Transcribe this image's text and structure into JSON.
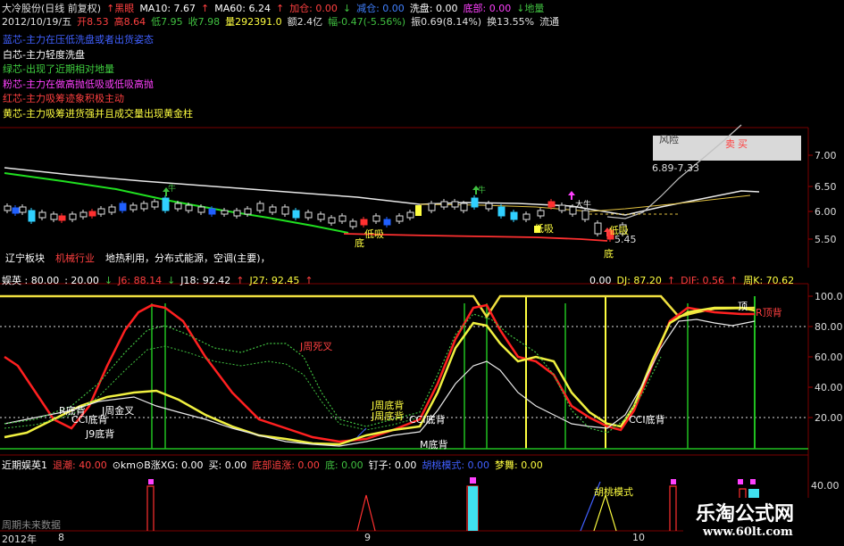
{
  "header": {
    "line1": [
      {
        "text": "大冷股份(日线 前复权)",
        "color": "#e0e0e0"
      },
      {
        "text": "↑黑眼",
        "color": "#ff4040"
      },
      {
        "text": "MA10: 7.67",
        "color": "#ffffff"
      },
      {
        "text": "↑",
        "color": "#ff4040"
      },
      {
        "text": "MA60: 6.24",
        "color": "#ffffff"
      },
      {
        "text": "↑",
        "color": "#ff4040"
      },
      {
        "text": "加仓: 0.00",
        "color": "#ff4040"
      },
      {
        "text": "↓",
        "color": "#40c040"
      },
      {
        "text": "减仓: 0.00",
        "color": "#4080ff"
      },
      {
        "text": "洗盘: 0.00",
        "color": "#ffffff"
      },
      {
        "text": "底部: 0.00",
        "color": "#ff40ff"
      },
      {
        "text": "↓地量",
        "color": "#40c040"
      }
    ],
    "line2": [
      {
        "text": "2012/10/19/五",
        "color": "#e0e0e0"
      },
      {
        "text": "开8.53",
        "color": "#ff4040"
      },
      {
        "text": "高8.64",
        "color": "#ff4040"
      },
      {
        "text": "低7.95",
        "color": "#40c040"
      },
      {
        "text": "收7.98",
        "color": "#40c040"
      },
      {
        "text": "量292391.0",
        "color": "#ffff40"
      },
      {
        "text": "额2.4亿",
        "color": "#e0e0e0"
      },
      {
        "text": "幅-0.47(-5.56%)",
        "color": "#40c040"
      },
      {
        "text": "振0.69(8.14%)",
        "color": "#e0e0e0"
      },
      {
        "text": "换13.55%",
        "color": "#e0e0e0"
      },
      {
        "text": "流通",
        "color": "#e0e0e0"
      }
    ]
  },
  "legend": [
    {
      "text": "蓝芯-主力在压低洗盘或者出货姿态",
      "color": "#4060ff"
    },
    {
      "text": "白芯-主力轻度洗盘",
      "color": "#ffffff"
    },
    {
      "text": "绿芯-出现了近期相对地量",
      "color": "#40d040"
    },
    {
      "text": "粉芯-主力在做高抛低吸或低吸高抛",
      "color": "#ff40ff"
    },
    {
      "text": "红芯-主力吸筹迹象积极主动",
      "color": "#ff4040"
    },
    {
      "text": "黄芯-主力吸筹进货强并且成交量出现黄金柱",
      "color": "#ffff40"
    }
  ],
  "price_panel": {
    "axis_labels": [
      "7.00",
      "6.50",
      "6.00",
      "5.50"
    ],
    "risk_label": "风险",
    "range_label": "6.89-7.33",
    "sell_label": "卖",
    "buy_label": "买",
    "annotations": [
      "底",
      "低吸",
      "低吸",
      "底",
      "5.45",
      "低吸",
      "低吸",
      "牛",
      "牛",
      "大牛"
    ]
  },
  "sector_row": [
    {
      "text": "辽宁板块",
      "color": "#ffffff"
    },
    {
      "text": "机械行业",
      "color": "#ff4040"
    },
    {
      "text": "地热利用，分布式能源，空调(主要)，",
      "color": "#ffffff"
    }
  ],
  "indicator_header": {
    "left": [
      {
        "text": "娱英 : 80.00",
        "color": "#ffffff"
      },
      {
        "text": ": 20.00",
        "color": "#ffffff"
      },
      {
        "text": "↓",
        "color": "#40c040"
      },
      {
        "text": "J6: 88.14",
        "color": "#ff4040"
      },
      {
        "text": "↓",
        "color": "#40c040"
      },
      {
        "text": "J18: 92.42",
        "color": "#ffffff"
      },
      {
        "text": "↑",
        "color": "#ff4040"
      },
      {
        "text": "J27: 92.45",
        "color": "#ffff40"
      },
      {
        "text": "↑",
        "color": "#ff4040"
      }
    ],
    "right": [
      {
        "text": "0.00",
        "color": "#ffffff"
      },
      {
        "text": "DJ: 87.20",
        "color": "#ffff40"
      },
      {
        "text": "↑",
        "color": "#ff4040"
      },
      {
        "text": "DIF: 0.56",
        "color": "#ff4040"
      },
      {
        "text": "↑",
        "color": "#ff4040"
      },
      {
        "text": "周K: 70.62",
        "color": "#ffff40"
      }
    ]
  },
  "indicator_panel": {
    "axis_labels": [
      "100.0",
      "80.00",
      "60.00",
      "40.00",
      "20.00"
    ],
    "annotations": [
      {
        "text": "J周死叉",
        "color": "#ff4040"
      },
      {
        "text": "R底背",
        "color": "#ffffff"
      },
      {
        "text": "J周金叉",
        "color": "#ffffff"
      },
      {
        "text": "CCI底背",
        "color": "#ffffff"
      },
      {
        "text": "J9底背",
        "color": "#ffffff"
      },
      {
        "text": "J周底背",
        "color": "#ffff40"
      },
      {
        "text": "J周底背",
        "color": "#ffff40"
      },
      {
        "text": "CCI底背",
        "color": "#ffffff"
      },
      {
        "text": "M底背",
        "color": "#ffffff"
      },
      {
        "text": "CCI底背",
        "color": "#ffffff"
      },
      {
        "text": "R顶背",
        "color": "#ff4040"
      },
      {
        "text": "顶",
        "color": "#ffffff"
      }
    ]
  },
  "bottom_header": [
    {
      "text": "近期娱英1",
      "color": "#ffffff"
    },
    {
      "text": "退潮: 40.00",
      "color": "#ff4040"
    },
    {
      "text": "⊙km⊙B涨XG: 0.00",
      "color": "#ffffff"
    },
    {
      "text": "买: 0.00",
      "color": "#ffffff"
    },
    {
      "text": "底部追涨: 0.00",
      "color": "#ff4040"
    },
    {
      "text": "底: 0.00",
      "color": "#40c040"
    },
    {
      "text": "钉子: 0.00",
      "color": "#ffffff"
    },
    {
      "text": "胡桃模式: 0.00",
      "color": "#4060ff"
    },
    {
      "text": "梦舞: 0.00",
      "color": "#ffff40"
    }
  ],
  "bottom_panel": {
    "axis_label": "40.00",
    "pattern_label": "胡桃模式",
    "hint": "周期未来数据"
  },
  "time_axis": {
    "labels": [
      "2012年",
      "8",
      "9",
      "10"
    ]
  },
  "watermark": {
    "title": "乐淘公式网",
    "url": "www.60lt.com"
  }
}
